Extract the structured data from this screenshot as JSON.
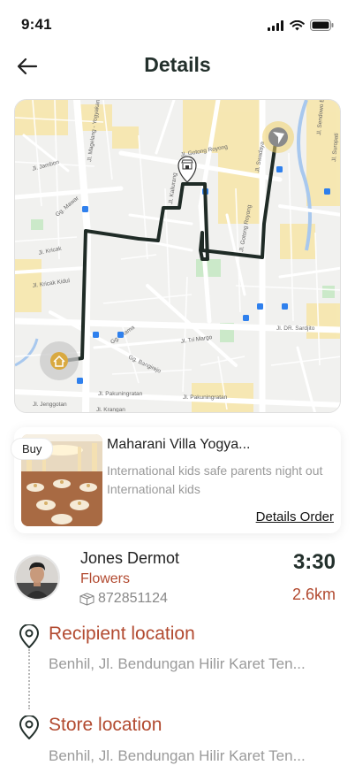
{
  "status_bar": {
    "time": "9:41"
  },
  "header": {
    "title": "Details"
  },
  "map": {
    "street_labels": [
      "Jl. Magelang - Yogyakarta",
      "Jl. Gotong Royong",
      "Jl. Kaliurang",
      "Jl. Swadaya",
      "Jl. Gotong Royong",
      "Jl. Jambon",
      "Gg. Mawar",
      "Jl. Kricak",
      "Jl. Kricak Kidul",
      "Jl. DR. Sardjito",
      "Jl. Tri Margo",
      "Gg. Utama",
      "Gg. Bangirejo",
      "Jl. Pakuningratan",
      "Jl. Jenggotan",
      "Jl. Krangan",
      "Jl. Sendowo E",
      "Jl. Suropati"
    ]
  },
  "order": {
    "badge": "Buy",
    "title": "Maharani Villa Yogya...",
    "description": "International kids safe parents night out International kids",
    "details_link": "Details Order"
  },
  "courier": {
    "name": "Jones Dermot",
    "category": "Flowers",
    "id_number": "872851124",
    "eta_time": "3:30",
    "distance": "2.6km"
  },
  "locations": {
    "recipient": {
      "title": "Recipient location",
      "address": "Benhil, Jl. Bendungan Hilir Karet Ten..."
    },
    "store": {
      "title": "Store location",
      "address": "Benhil, Jl. Bendungan Hilir Karet Ten..."
    }
  },
  "colors": {
    "accent": "#b24a30",
    "route": "#1f2b26",
    "title": "#23302c",
    "home_marker": "#d9a940",
    "nav_marker": "#f1d26a"
  }
}
